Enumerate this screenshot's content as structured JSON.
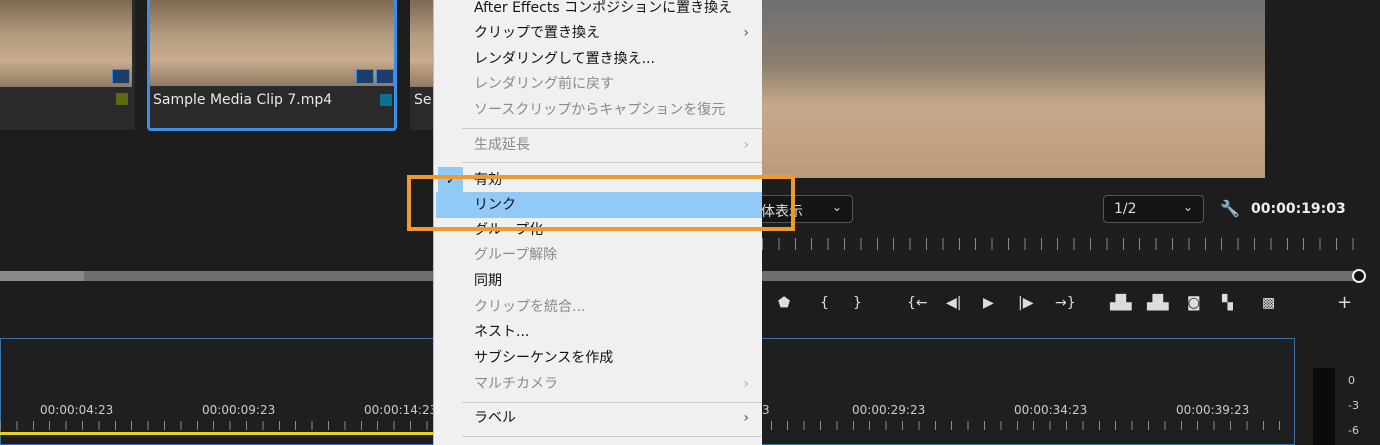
{
  "project_panel": {
    "clips": [
      {
        "name": "",
        "label_color": "#5a6a10"
      },
      {
        "name": "Sample Media Clip 7.mp4",
        "label_color": "#0e6e94"
      },
      {
        "name": "Se"
      }
    ]
  },
  "program_monitor": {
    "zoom_select": "体表示",
    "resolution_select": "1/2",
    "timecode": "00:00:19:03"
  },
  "timeline": {
    "labels": [
      "00:00:04:23",
      "00:00:09:23",
      "00:00:14:23",
      "3",
      "00:00:29:23",
      "00:00:34:23",
      "00:00:39:23"
    ]
  },
  "audio_meter": {
    "labels": [
      "0",
      "-3",
      "-6"
    ]
  },
  "context_menu": {
    "items": [
      {
        "label": "After Effects コンポジションに置き換え",
        "disabled": false
      },
      {
        "label": "クリップで置き換え",
        "disabled": false,
        "submenu": true
      },
      {
        "label": "レンダリングして置き換え...",
        "disabled": false
      },
      {
        "label": "レンダリング前に戻す",
        "disabled": true
      },
      {
        "label": "ソースクリップからキャプションを復元",
        "disabled": true
      },
      {
        "label": "生成延長",
        "disabled": true,
        "submenu": true
      },
      {
        "label": "有効",
        "checked": true
      },
      {
        "label": "リンク",
        "highlighted": true
      },
      {
        "label": "グループ化",
        "disabled": false
      },
      {
        "label": "グループ解除",
        "disabled": true
      },
      {
        "label": "同期",
        "disabled": false
      },
      {
        "label": "クリップを統合...",
        "disabled": true
      },
      {
        "label": "ネスト...",
        "disabled": false
      },
      {
        "label": "サブシーケンスを作成",
        "disabled": false
      },
      {
        "label": "マルチカメラ",
        "disabled": true,
        "submenu": true
      },
      {
        "label": "ラベル",
        "disabled": false,
        "submenu": true
      }
    ],
    "arrow": "›",
    "check": "✓"
  },
  "accent": "#ef9a2b"
}
